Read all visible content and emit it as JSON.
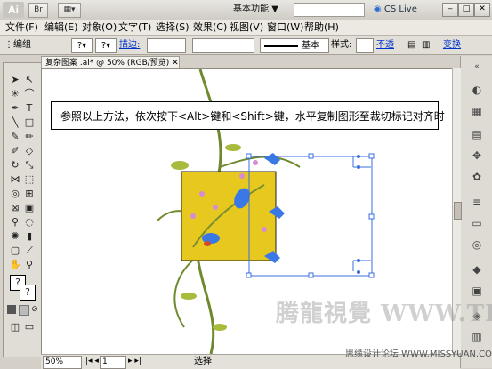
{
  "titlebar": {
    "app_logo": "Ai",
    "workspace": "基本功能",
    "workspace_arrow": "▼",
    "cs_live": "CS Live",
    "min": "‒",
    "max": "□",
    "close": "✕"
  },
  "menu": [
    "文件(F)",
    "编辑(E)",
    "对象(O)",
    "文字(T)",
    "选择(S)",
    "效果(C)",
    "视图(V)",
    "窗口(W)",
    "帮助(H)"
  ],
  "control": {
    "group_label": "编组",
    "stroke_label": "描边:",
    "brush_label": "基本",
    "style_label": "样式:",
    "opacity_link": "不透",
    "transform_link": "变换"
  },
  "doc_tab": "复杂图案 .ai* @ 50% (RGB/预览)",
  "callout": "参照以上方法，依次按下<Alt>键和<Shift>键，水平复制图形至裁切标记对齐时",
  "watermark": "腾龍視覺 WWW.TLVI.NET",
  "forum": "思缘设计论坛  WWW.MISSYUAN.COM",
  "status": {
    "zoom": "50%",
    "page": "1",
    "tool": "选择"
  },
  "colors": {
    "artboard_fill": "#e6c81e",
    "selection": "#3a6ee0",
    "bird_blue": "#3a78e6",
    "vine": "#6f8a2e"
  }
}
